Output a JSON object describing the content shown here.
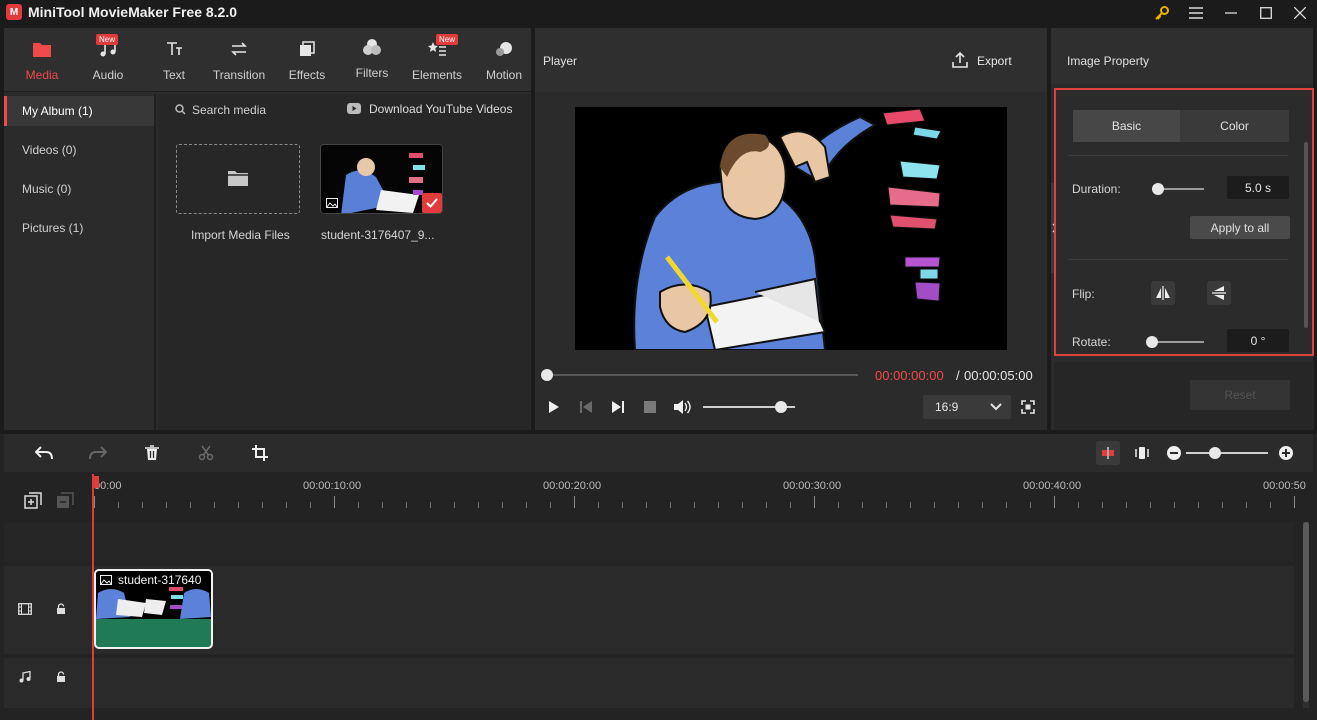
{
  "window": {
    "title": "MiniTool MovieMaker Free 8.2.0"
  },
  "media_tabs": [
    {
      "label": "Media",
      "icon": "folder-icon",
      "badge": ""
    },
    {
      "label": "Audio",
      "icon": "music-note-icon",
      "badge": "New"
    },
    {
      "label": "Text",
      "icon": "text-icon",
      "badge": ""
    },
    {
      "label": "Transition",
      "icon": "transition-arrows-icon",
      "badge": ""
    },
    {
      "label": "Effects",
      "icon": "effects-icon",
      "badge": ""
    },
    {
      "label": "Filters",
      "icon": "filters-icon",
      "badge": ""
    },
    {
      "label": "Elements",
      "icon": "elements-icon",
      "badge": "New"
    },
    {
      "label": "Motion",
      "icon": "motion-icon",
      "badge": ""
    }
  ],
  "albums": [
    {
      "label": "My Album (1)",
      "active": true
    },
    {
      "label": "Videos (0)",
      "active": false
    },
    {
      "label": "Music (0)",
      "active": false
    },
    {
      "label": "Pictures (1)",
      "active": false
    }
  ],
  "media": {
    "search_placeholder": "Search media",
    "download_label": "Download YouTube Videos",
    "import_label": "Import Media Files",
    "item_name": "student-3176407_9..."
  },
  "player": {
    "title": "Player",
    "export_label": "Export",
    "current_time": "00:00:00:00",
    "time_separator": "/",
    "total_time": "00:00:05:00",
    "aspect_ratio": "16:9",
    "progress": 0,
    "volume": 0.85
  },
  "property": {
    "title": "Image Property",
    "tab_basic": "Basic",
    "tab_color": "Color",
    "duration_label": "Duration:",
    "duration_value": "5.0 s",
    "duration_level": 0.12,
    "apply_all_label": "Apply to all",
    "flip_label": "Flip:",
    "rotate_label": "Rotate:",
    "rotate_value": "0 °",
    "rotate_level": 0.0,
    "reset_label": "Reset"
  },
  "timeline": {
    "ruler_labels": [
      "00:00",
      "00:00:10:00",
      "00:00:20:00",
      "00:00:30:00",
      "00:00:40:00",
      "00:00:50"
    ],
    "clip_name": "student-317640",
    "zoom_level": 0.35
  },
  "colors": {
    "accent": "#ef4a4a",
    "highlight_border": "#e04040",
    "clip_green": "#1f7a55"
  }
}
